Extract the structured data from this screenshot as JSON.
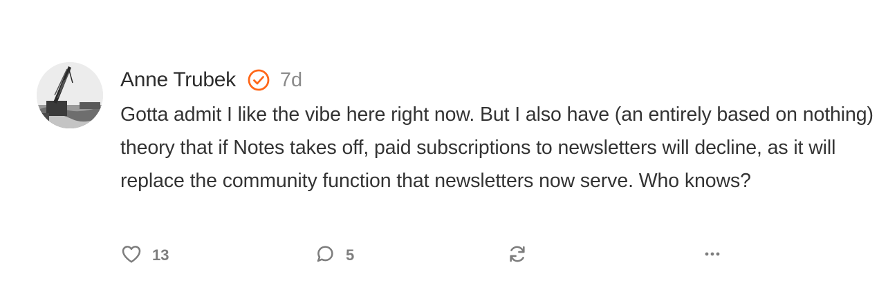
{
  "note": {
    "author": "Anne Trubek",
    "time": "7d",
    "text": "Gotta admit I like the vibe here right now. But I also have (an entirely based on nothing) theory that if Notes takes off, paid subscriptions to newsletters will decline, as it will replace the community function that newsletters now serve. Who knows?",
    "accent_color": "#ff6719"
  },
  "actions": {
    "likes": "13",
    "comments": "5",
    "icons": [
      "heart-icon",
      "comment-icon",
      "restack-icon",
      "more-icon"
    ]
  }
}
